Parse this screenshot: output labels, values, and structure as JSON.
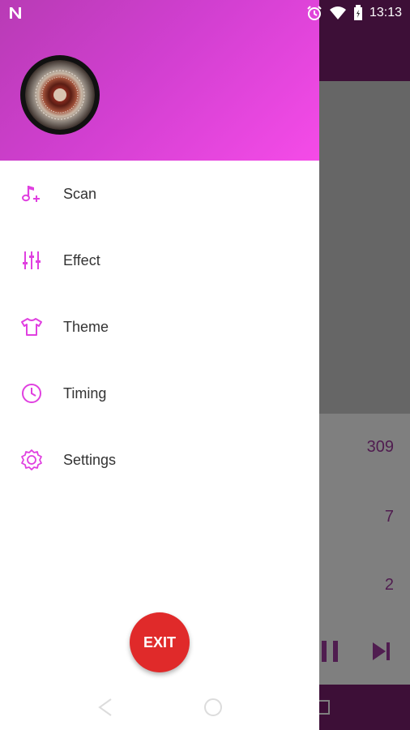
{
  "status_bar": {
    "time": "13:13",
    "left_icon": "n-notification-icon",
    "icons": [
      "alarm-icon",
      "wifi-icon",
      "battery-icon"
    ]
  },
  "background": {
    "values": [
      "309",
      "7",
      "2"
    ]
  },
  "drawer": {
    "menu": [
      {
        "label": "Scan",
        "icon": "music-note-add-icon"
      },
      {
        "label": "Effect",
        "icon": "equalizer-icon"
      },
      {
        "label": "Theme",
        "icon": "tshirt-icon"
      },
      {
        "label": "Timing",
        "icon": "clock-icon"
      },
      {
        "label": "Settings",
        "icon": "gear-icon"
      }
    ],
    "exit_label": "EXIT"
  },
  "colors": {
    "accent": "#e040e0",
    "header_start": "#b83bb5",
    "header_end": "#f54be8",
    "exit": "#e02a2a",
    "appbar": "#7b1f6e"
  }
}
